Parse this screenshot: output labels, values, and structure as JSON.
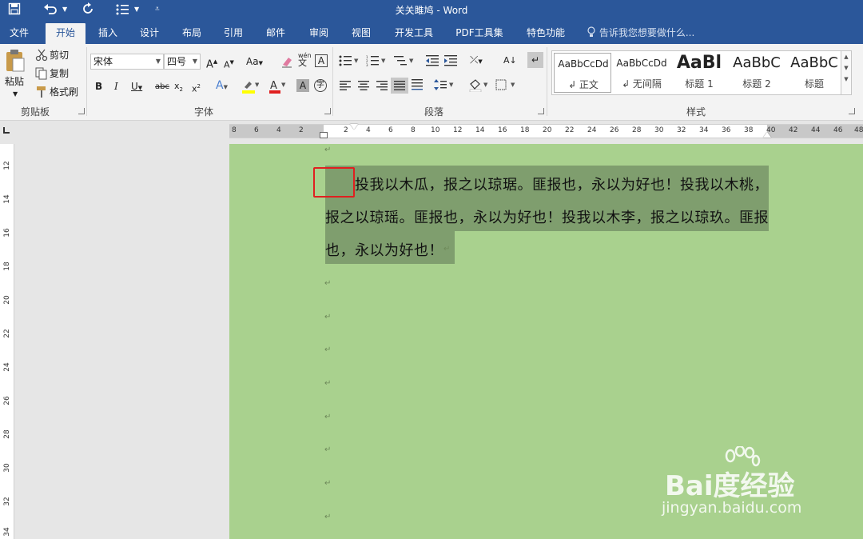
{
  "window": {
    "title": "关关雎鸠 - Word"
  },
  "quick_access": {
    "save_icon": "save-icon",
    "undo_icon": "undo-icon",
    "redo_icon": "redo-icon",
    "customize_icon": "customize-icon"
  },
  "tabs": [
    {
      "label": "文件"
    },
    {
      "label": "开始"
    },
    {
      "label": "插入"
    },
    {
      "label": "设计"
    },
    {
      "label": "布局"
    },
    {
      "label": "引用"
    },
    {
      "label": "邮件"
    },
    {
      "label": "审阅"
    },
    {
      "label": "视图"
    },
    {
      "label": "开发工具"
    },
    {
      "label": "PDF工具集"
    },
    {
      "label": "特色功能"
    }
  ],
  "tell_me": "告诉我您想要做什么...",
  "clipboard": {
    "paste": "粘贴",
    "cut": "剪切",
    "copy": "复制",
    "format_painter": "格式刷",
    "group": "剪贴板"
  },
  "font": {
    "name": "宋体",
    "size": "四号",
    "group": "字体",
    "wen": "wén"
  },
  "paragraph": {
    "group": "段落"
  },
  "styles": {
    "group": "样式",
    "items": [
      {
        "sample": "AaBbCcDd",
        "name": "↲ 正文"
      },
      {
        "sample": "AaBbCcDd",
        "name": "↲ 无间隔"
      },
      {
        "sample": "AaBl",
        "name": "标题 1"
      },
      {
        "sample": "AaBbC",
        "name": "标题 2"
      },
      {
        "sample": "AaBbC",
        "name": "标题"
      }
    ]
  },
  "hruler": [
    "8",
    "6",
    "4",
    "2",
    "2",
    "4",
    "6",
    "8",
    "10",
    "12",
    "14",
    "16",
    "18",
    "20",
    "22",
    "24",
    "26",
    "28",
    "30",
    "32",
    "34",
    "36",
    "38",
    "40",
    "42",
    "44",
    "46",
    "48"
  ],
  "vruler": [
    "12",
    "14",
    "16",
    "18",
    "20",
    "22",
    "24",
    "26",
    "28",
    "30",
    "32",
    "34"
  ],
  "document": {
    "line1": "投我以木瓜，报之以琼琚。匪报也，永以为好也！投我以木桃，",
    "line2": "报之以琼瑶。匪报也，永以为好也！投我以木李，报之以琼玖。匪报",
    "line3": "也，永以为好也！",
    "para_mark": "↵"
  },
  "watermark": {
    "brand": "Bai度经验",
    "url": "jingyan.baidu.com"
  }
}
